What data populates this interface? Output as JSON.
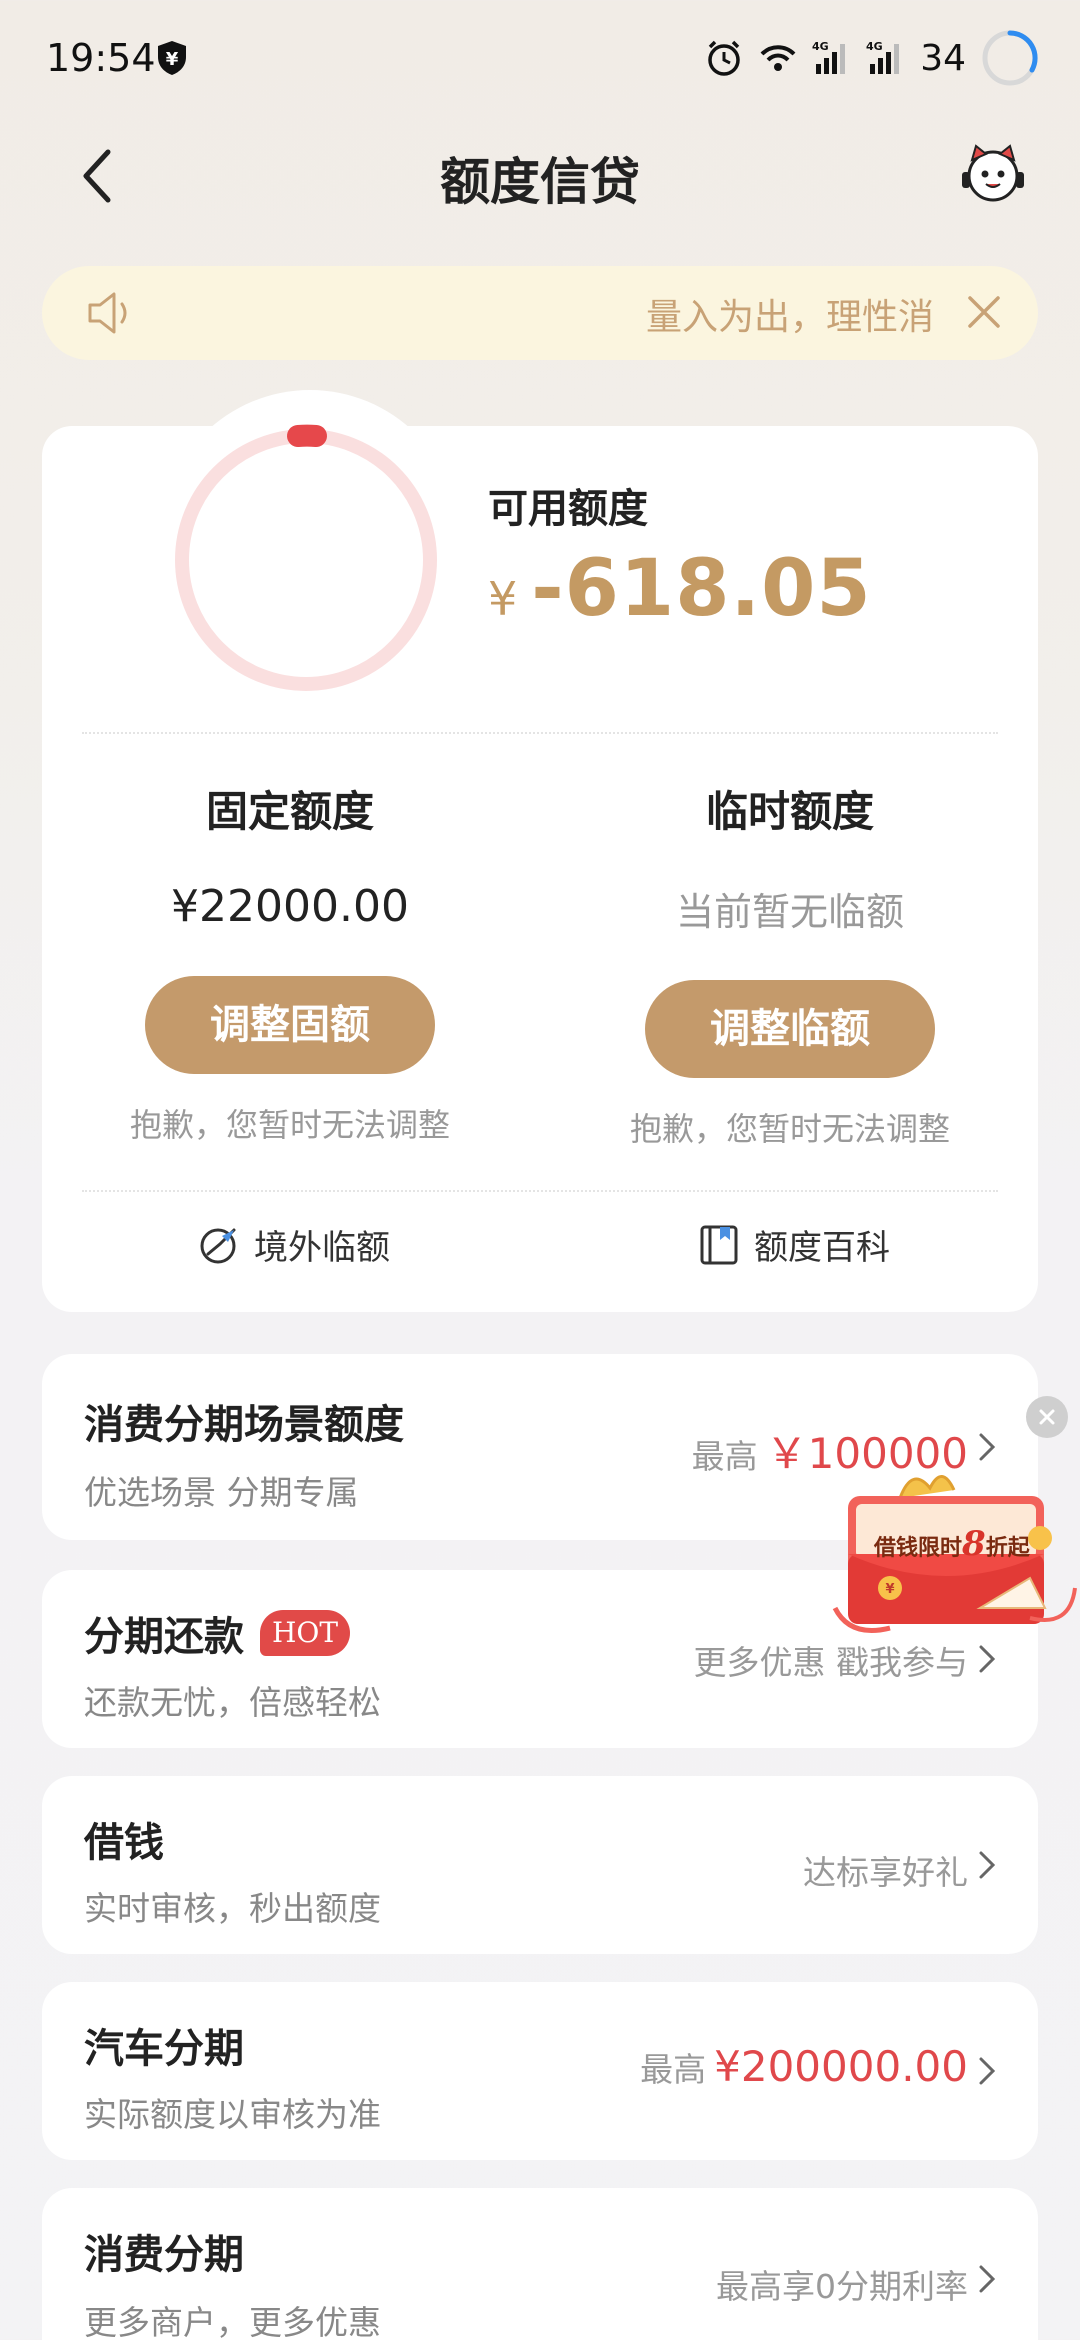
{
  "status_bar": {
    "time": "19:54",
    "battery": "34"
  },
  "header": {
    "title": "额度信贷"
  },
  "notice": {
    "text": "量入为出，理性消"
  },
  "credit": {
    "available_label": "可用额度",
    "currency": "¥",
    "available_amount": "-618.05",
    "fixed": {
      "title": "固定额度",
      "value": "¥22000.00",
      "button": "调整固额",
      "note": "抱歉，您暂时无法调整"
    },
    "temp": {
      "title": "临时额度",
      "value": "当前暂无临额",
      "button": "调整临额",
      "note": "抱歉，您暂时无法调整"
    },
    "links": {
      "overseas": "境外临额",
      "encyclopedia": "额度百科"
    }
  },
  "list": [
    {
      "title": "消费分期场景额度",
      "subtitle": "优选场景 分期专属",
      "right_prefix": "最高",
      "right_value": "￥100000"
    },
    {
      "title": "分期还款",
      "badge": "HOT",
      "subtitle": "还款无忧，倍感轻松",
      "right_text": "更多优惠 戳我参与"
    },
    {
      "title": "借钱",
      "subtitle": "实时审核，秒出额度",
      "right_text": "达标享好礼"
    },
    {
      "title": "汽车分期",
      "subtitle": "实际额度以审核为准",
      "right_prefix": "最高",
      "right_value": "¥200000.00"
    },
    {
      "title": "消费分期",
      "subtitle": "更多商户，更多优惠",
      "right_text": "最高享0分期利率"
    }
  ],
  "promo": {
    "text_a": "借钱限时",
    "text_num": "8",
    "text_b": "折起"
  },
  "colors": {
    "accent": "#c49a6b",
    "red": "#e0484b",
    "notice_bg": "#fbf5df"
  }
}
